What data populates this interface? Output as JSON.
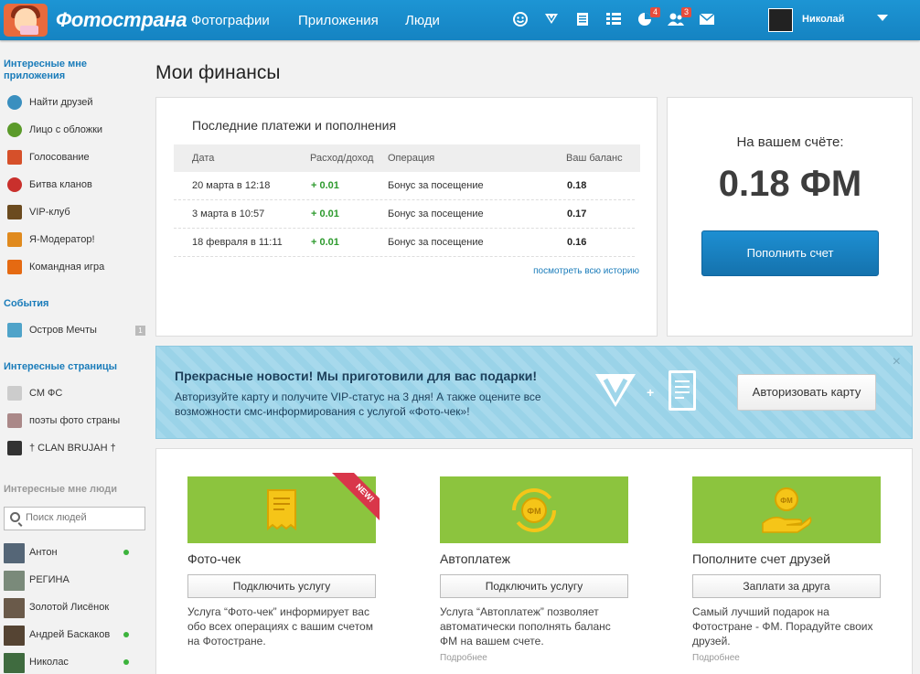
{
  "header": {
    "logo_text": "Фотострана",
    "nav": [
      "Фотографии",
      "Приложения",
      "Люди"
    ],
    "icons": [
      {
        "name": "smiley-icon",
        "badge": ""
      },
      {
        "name": "vip-icon",
        "badge": ""
      },
      {
        "name": "news-icon",
        "badge": ""
      },
      {
        "name": "list-icon",
        "badge": ""
      },
      {
        "name": "events-icon",
        "badge": "4"
      },
      {
        "name": "friends-icon",
        "badge": "3"
      },
      {
        "name": "mail-icon",
        "badge": ""
      }
    ],
    "user_name": "Николай"
  },
  "sidebar": {
    "apps_title": "Интересные мне приложения",
    "apps": [
      {
        "label": "Найти друзей",
        "icon": "find-friends-icon",
        "color": "#3a8fbf"
      },
      {
        "label": "Лицо с обложки",
        "icon": "cover-face-icon",
        "color": "#5b9a2a"
      },
      {
        "label": "Голосование",
        "icon": "vote-icon",
        "color": "#d6502a"
      },
      {
        "label": "Битва кланов",
        "icon": "clan-battle-icon",
        "color": "#c9302c"
      },
      {
        "label": "VIP-клуб",
        "icon": "vip-club-icon",
        "color": "#6b4b1f"
      },
      {
        "label": "Я-Модератор!",
        "icon": "moderator-icon",
        "color": "#e08a1e"
      },
      {
        "label": "Командная игра",
        "icon": "team-game-icon",
        "color": "#e56a12"
      }
    ],
    "events_title": "События",
    "events": [
      {
        "label": "Остров Мечты",
        "count": "1"
      }
    ],
    "pages_title": "Интересные страницы",
    "pages": [
      {
        "label": "СМ ФС"
      },
      {
        "label": "поэты фото страны"
      },
      {
        "label": "† CLAN BRUJAH †"
      }
    ],
    "people_title": "Интересные мне люди",
    "search_placeholder": "Поиск людей",
    "people": [
      {
        "name": "Антон",
        "online": true
      },
      {
        "name": "РЕГИНА",
        "online": false
      },
      {
        "name": "Золотой Лисёнок",
        "online": false
      },
      {
        "name": "Андрей Баскаков",
        "online": true
      },
      {
        "name": "Николас",
        "online": true
      }
    ]
  },
  "main": {
    "title": "Мои финансы",
    "payments": {
      "title": "Последние платежи и пополнения",
      "columns": [
        "Дата",
        "Расход/доход",
        "Операция",
        "Ваш баланс"
      ],
      "rows": [
        {
          "date": "20 марта в 12:18",
          "amount": "+ 0.01",
          "operation": "Бонус за посещение",
          "balance": "0.18"
        },
        {
          "date": "3 марта в 10:57",
          "amount": "+ 0.01",
          "operation": "Бонус за посещение",
          "balance": "0.17"
        },
        {
          "date": "18 февраля в 11:11",
          "amount": "+ 0.01",
          "operation": "Бонус за посещение",
          "balance": "0.16"
        }
      ],
      "history_link": "посмотреть всю историю"
    },
    "balance": {
      "label": "На вашем счёте:",
      "value": "0.18 ФМ",
      "button": "Пополнить счет"
    },
    "banner": {
      "title": "Прекрасные новости! Мы приготовили для вас подарки!",
      "text": "Авторизуйте карту и получите VIP-статус на 3 дня! А также оцените все возможности смс-информирования с услугой «Фото-чек»!",
      "plus": "+",
      "button": "Авторизовать карту",
      "close": "×"
    },
    "services": [
      {
        "title": "Фото-чек",
        "button": "Подключить услугу",
        "description": "Услуга “Фото-чек” информирует вас обо всех операциях с вашим счетом на Фотостране.",
        "more": "",
        "ribbon": "NEW!"
      },
      {
        "title": "Автоплатеж",
        "button": "Подключить услугу",
        "description": "Услуга “Автоплатеж” позволяет автоматически пополнять баланс ФМ на вашем счете.",
        "more": "Подробнее",
        "ribbon": ""
      },
      {
        "title": "Пополните счет друзей",
        "button": "Заплати за друга",
        "description": "Самый лучший подарок на Фотостране - ФМ. Порадуйте своих друзей.",
        "more": "Подробнее",
        "ribbon": ""
      }
    ],
    "coin_label": "ФМ"
  }
}
